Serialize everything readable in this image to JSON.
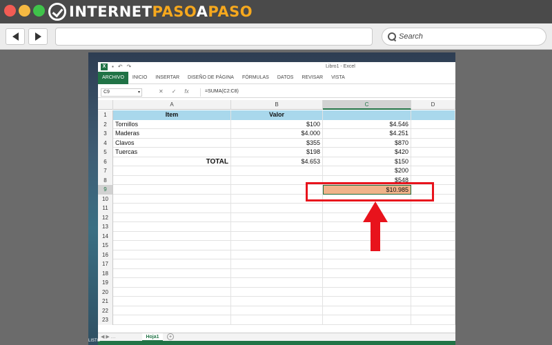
{
  "browser": {
    "logo_part1": "INTERNET",
    "logo_part2": "PASO",
    "logo_part3": "A",
    "logo_part4": "PASO",
    "search_placeholder": "Search"
  },
  "excel": {
    "doc_title": "Libro1 - Excel",
    "ribbon_tabs": [
      "ARCHIVO",
      "INICIO",
      "INSERTAR",
      "DISEÑO DE PÁGINA",
      "FÓRMULAS",
      "DATOS",
      "REVISAR",
      "VISTA"
    ],
    "name_box": "C9",
    "formula": "=SUMA(C2:C8)",
    "fx_label": "fx",
    "columns": [
      "A",
      "B",
      "C",
      "D"
    ],
    "row_numbers": [
      "1",
      "2",
      "3",
      "4",
      "5",
      "6",
      "7",
      "8",
      "9",
      "10",
      "11",
      "12",
      "13",
      "14",
      "15",
      "16",
      "17",
      "18",
      "19",
      "20",
      "21",
      "22",
      "23"
    ],
    "header_item": "Item",
    "header_valor": "Valor",
    "rows": [
      {
        "item": "Tornillos",
        "b": "$100",
        "c": "$4.546"
      },
      {
        "item": "Maderas",
        "b": "$4.000",
        "c": "$4.251"
      },
      {
        "item": "Clavos",
        "b": "$355",
        "c": "$870"
      },
      {
        "item": "Tuercas",
        "b": "$198",
        "c": "$420"
      }
    ],
    "total_label": "TOTAL",
    "total_b": "$4.653",
    "c6": "$150",
    "c7": "$200",
    "c8": "$548",
    "c9": "$10.985",
    "sheet_tab": "Hoja1",
    "status": "LISTO"
  },
  "annotation": {
    "color": "#e8131c"
  }
}
